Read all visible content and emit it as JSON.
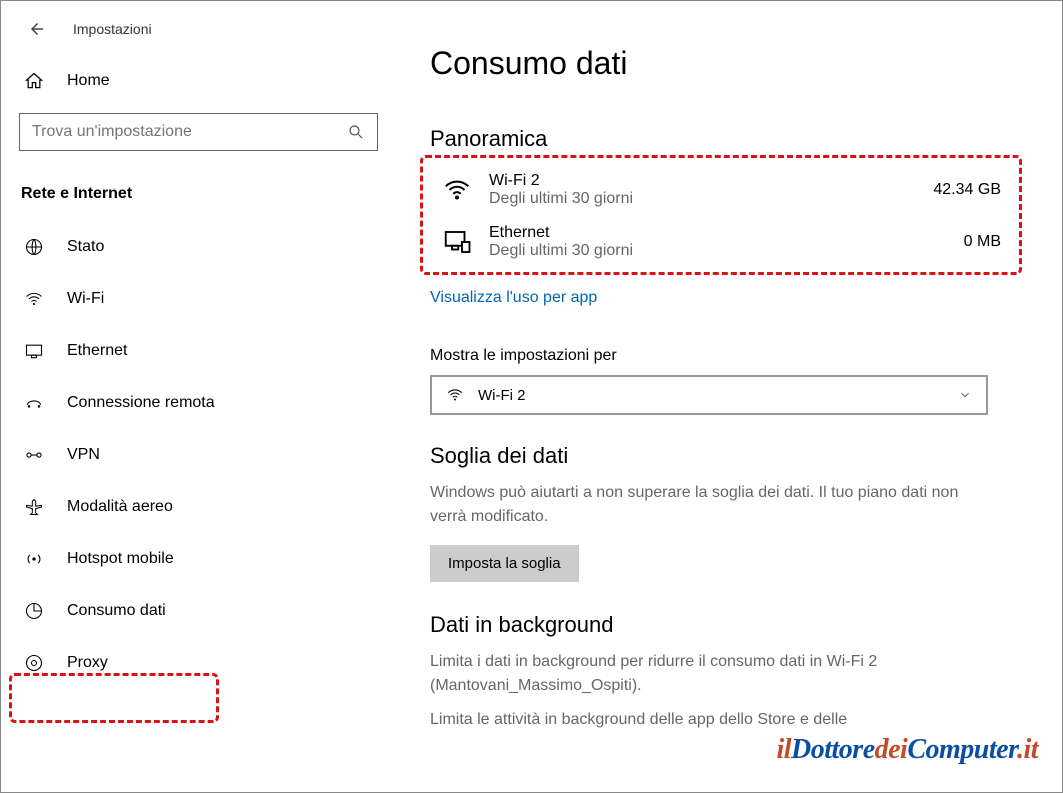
{
  "app_title": "Impostazioni",
  "home_label": "Home",
  "search": {
    "placeholder": "Trova un'impostazione"
  },
  "category": "Rete e Internet",
  "nav": [
    {
      "label": "Stato"
    },
    {
      "label": "Wi-Fi"
    },
    {
      "label": "Ethernet"
    },
    {
      "label": "Connessione remota"
    },
    {
      "label": "VPN"
    },
    {
      "label": "Modalità aereo"
    },
    {
      "label": "Hotspot mobile"
    },
    {
      "label": "Consumo dati"
    },
    {
      "label": "Proxy"
    }
  ],
  "page_title": "Consumo dati",
  "overview": {
    "heading": "Panoramica",
    "items": [
      {
        "name": "Wi-Fi 2",
        "sub": "Degli ultimi 30 giorni",
        "value": "42.34 GB"
      },
      {
        "name": "Ethernet",
        "sub": "Degli ultimi 30 giorni",
        "value": "0 MB"
      }
    ],
    "link": "Visualizza l'uso per app"
  },
  "show_for": {
    "label": "Mostra le impostazioni per",
    "selected": "Wi-Fi 2"
  },
  "threshold": {
    "heading": "Soglia dei dati",
    "desc": "Windows può aiutarti a non superare la soglia dei dati. Il tuo piano dati non verrà modificato.",
    "button": "Imposta la soglia"
  },
  "background": {
    "heading": "Dati in background",
    "desc1": "Limita i dati in background per ridurre il consumo dati in Wi-Fi 2 (Mantovani_Massimo_Ospiti).",
    "desc2": "Limita le attività in background delle app dello Store e delle"
  },
  "watermark": "ilDottoredeiComputer.it"
}
